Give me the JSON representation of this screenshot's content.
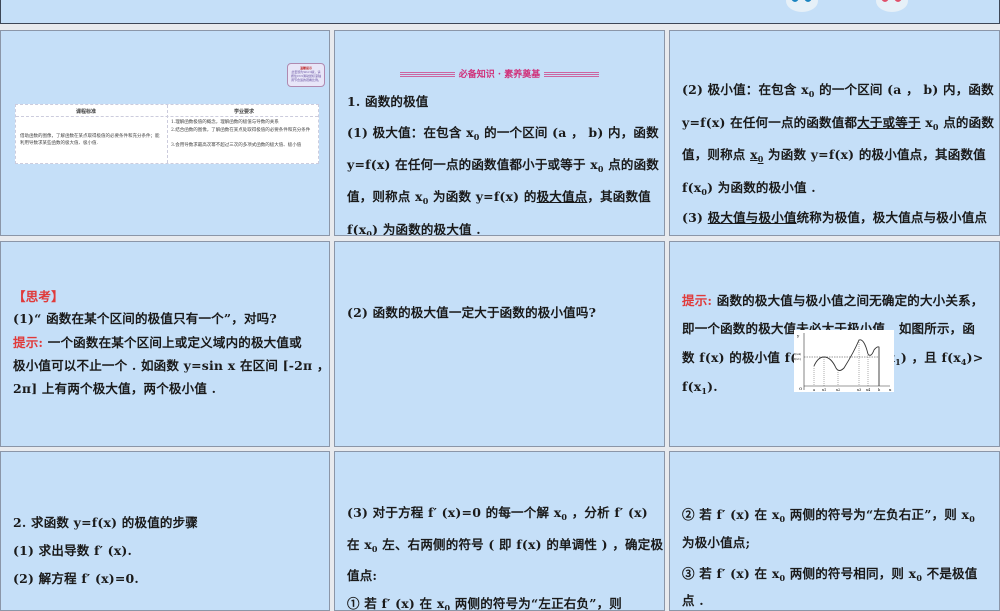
{
  "colors": {
    "slide_bg": "#c5dff8",
    "accent_red": "#e03a3a",
    "header_pink": "#d0317a"
  },
  "slides": [
    {
      "id": "s1",
      "note_title": "温馨提示",
      "note_text": "此套题为Word版，请按住Ctrl滑动鼠标滚轴调节合适的观看比例。",
      "table": {
        "headers": [
          "课程标准",
          "学业要求"
        ],
        "left": "借助函数的图像，了解函数在某点取得极值的必要条件和充分条件；能利用导数求某些函数的极大值、极小值.",
        "right": [
          "1.理解函数极值的概念，理解函数的极值与导数的关系",
          "2.结合函数的图像，了解函数在某点处取得极值的必要条件和充分条件",
          "3.会用导数求最高次幂不超过三次的多项式函数的极大值、极小值"
        ]
      }
    },
    {
      "id": "s2",
      "header": "必备知识 · 素养奠基",
      "lines": [
        [
          [
            "1. 函数的极值",
            "n"
          ]
        ],
        [
          [
            "(1) 极大值：在包含 x",
            "n"
          ],
          [
            "0",
            "s"
          ],
          [
            " 的一个区间 (a ， b) 内，函数",
            "n"
          ]
        ],
        [
          [
            "y=f(x) 在任何一点的函数值都小于或等于 x",
            "n"
          ],
          [
            "0",
            "s"
          ],
          [
            " 点的函数",
            "n"
          ]
        ],
        [
          [
            "值，则称点 x",
            "n"
          ],
          [
            "0",
            "s"
          ],
          [
            " 为函数 y=f(x) 的",
            "n"
          ],
          [
            "极大值点",
            "u"
          ],
          [
            "，其函数值",
            "n"
          ]
        ],
        [
          [
            "f(x",
            "u"
          ],
          [
            "0",
            "us"
          ],
          [
            ")",
            "u"
          ],
          [
            " 为函数的极大值 .",
            "n"
          ]
        ]
      ]
    },
    {
      "id": "s3",
      "lines": [
        [
          [
            "(2) 极小值：在包含 x",
            "n"
          ],
          [
            "0",
            "s"
          ],
          [
            " 的一个区间 (a ， b) 内，函数",
            "n"
          ]
        ],
        [
          [
            "y=f(x) 在任何一点的函数值都",
            "n"
          ],
          [
            "大于或等于",
            "u"
          ],
          [
            " x",
            "n"
          ],
          [
            "0",
            "s"
          ],
          [
            " 点的函数",
            "n"
          ]
        ],
        [
          [
            "值，则称点 ",
            "n"
          ],
          [
            "x",
            "u"
          ],
          [
            "0",
            "us"
          ],
          [
            " 为函数 y=f(x) 的极小值点，其函数值",
            "n"
          ]
        ],
        [
          [
            "f(x",
            "n"
          ],
          [
            "0",
            "s"
          ],
          [
            ") 为函数的极小值 .",
            "n"
          ]
        ],
        [
          [
            "(3) ",
            "n"
          ],
          [
            "极大值与极小值",
            "u"
          ],
          [
            "统称为极值，极大值点与极小值点",
            "n"
          ]
        ]
      ]
    },
    {
      "id": "s4",
      "lines": [
        [
          [
            "【思考】",
            "r"
          ]
        ],
        [
          [
            "(1)“ 函数在某个区间的极值只有一个”，对吗?",
            "n"
          ]
        ],
        [
          [
            "提示: ",
            "r"
          ],
          [
            "一个函数在某个区间上或定义域内的极大值或",
            "n"
          ]
        ],
        [
          [
            "极小值可以不止一个 . 如函数 y=sin x 在区间 [-2π ，",
            "n"
          ]
        ],
        [
          [
            "2π] 上有两个极大值，两个极小值 .",
            "n"
          ]
        ]
      ]
    },
    {
      "id": "s5",
      "lines": [
        [
          [
            "(2) 函数的极大值一定大于函数的极小值吗?",
            "n"
          ]
        ]
      ]
    },
    {
      "id": "s6",
      "lines": [
        [
          [
            "提示: ",
            "r"
          ],
          [
            "函数的极大值与极小值之间无确定的大小关系，",
            "n"
          ]
        ],
        [
          [
            "即一个函数的极大值未必大于极小值 . 如图所示，函",
            "n"
          ]
        ],
        [
          [
            "数 f(x) 的极小值 f(x",
            "n"
          ],
          [
            "4",
            "s"
          ],
          [
            ") ，极大值 f(x",
            "n"
          ],
          [
            "1",
            "s"
          ],
          [
            ") ，且 f(x",
            "n"
          ],
          [
            "4",
            "s"
          ],
          [
            ")>",
            "n"
          ]
        ],
        [
          [
            "f(x",
            "n"
          ],
          [
            "1",
            "s"
          ],
          [
            ").",
            "n"
          ]
        ]
      ],
      "graph_labels": {
        "y": "y",
        "o": "O",
        "x": "x",
        "ticks": [
          "a",
          "x1",
          "x2",
          "x3",
          "x4",
          "b"
        ],
        "yticks": [
          "f(x4)",
          "f(x1)"
        ]
      }
    },
    {
      "id": "s7",
      "lines": [
        [
          [
            "2. 求函数 y=f(x) 的极值的步骤",
            "n"
          ]
        ],
        [
          [
            "(1) 求出导数 f′ (x).",
            "n"
          ]
        ],
        [
          [
            "(2) 解方程 f′ (x)=0.",
            "n"
          ]
        ]
      ]
    },
    {
      "id": "s8",
      "lines": [
        [
          [
            "(3) 对于方程 f′ (x)=0 的每一个解 x",
            "n"
          ],
          [
            "0",
            "s"
          ],
          [
            " ，分析 f′ (x)",
            "n"
          ]
        ],
        [
          [
            "在 x",
            "n"
          ],
          [
            "0",
            "s"
          ],
          [
            " 左、右两侧的符号 ( 即 f(x) 的单调性 ) ，确定极",
            "n"
          ]
        ],
        [
          [
            "值点:",
            "n"
          ]
        ],
        [
          [
            "① 若 f′ (x) 在 x",
            "n"
          ],
          [
            "0",
            "s"
          ],
          [
            " 两侧的符号为“左正右负”，则",
            "n"
          ]
        ]
      ]
    },
    {
      "id": "s9",
      "lines": [
        [
          [
            "② 若 f′ (x) 在 x",
            "n"
          ],
          [
            "0",
            "s"
          ],
          [
            " 两侧的符号为“左负右正”，则 x",
            "n"
          ],
          [
            "0",
            "s"
          ]
        ],
        [
          [
            "为极小值点;",
            "n"
          ]
        ],
        [
          [
            "③ 若 f′ (x) 在 x",
            "n"
          ],
          [
            "0",
            "s"
          ],
          [
            " 两侧的符号相同，则 x",
            "n"
          ],
          [
            "0",
            "s"
          ],
          [
            " 不是极值",
            "n"
          ]
        ],
        [
          [
            "点 .",
            "n"
          ]
        ]
      ]
    }
  ]
}
